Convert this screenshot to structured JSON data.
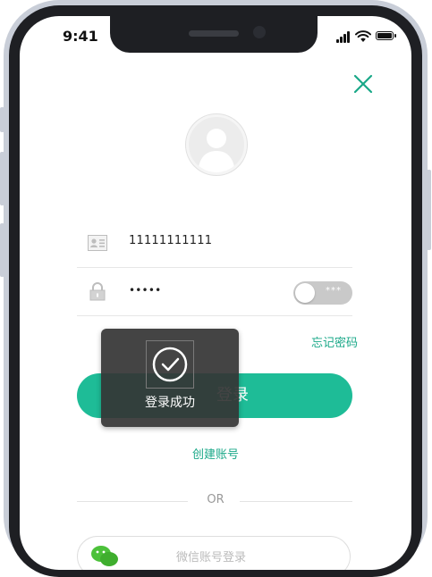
{
  "status_bar": {
    "time": "9:41"
  },
  "login": {
    "account_value": "11111111111",
    "password_value": "•••••",
    "toggle_text": "***",
    "forgot_password": "忘记密码",
    "login_button": "登录",
    "create_account": "创建账号",
    "or_divider": "OR",
    "wechat_login": "微信账号登录"
  },
  "toast": {
    "message": "登录成功"
  },
  "colors": {
    "accent": "#1ebc97",
    "link": "#1aa888",
    "toast_bg": "#343434",
    "wechat_green": "#4cc13a"
  },
  "icons": [
    "close-icon",
    "avatar-icon",
    "id-card-icon",
    "lock-icon",
    "check-circle-icon",
    "wechat-icon"
  ]
}
